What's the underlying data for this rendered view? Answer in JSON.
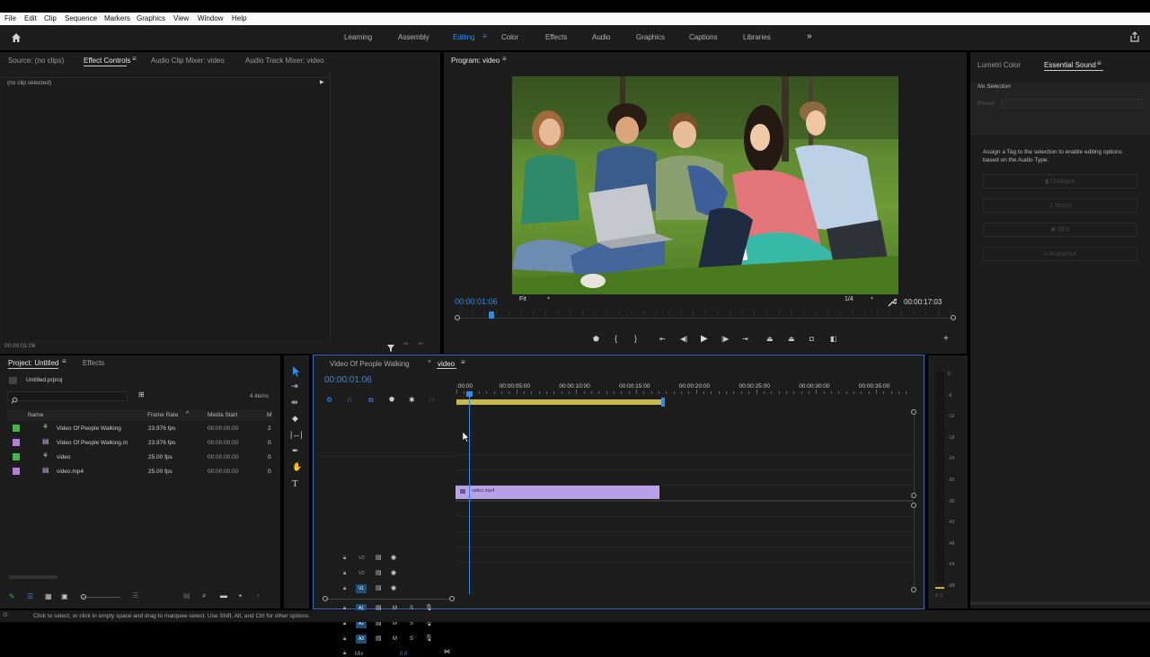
{
  "menu": [
    "File",
    "Edit",
    "Clip",
    "Sequence",
    "Markers",
    "Graphics",
    "View",
    "Window",
    "Help"
  ],
  "workspaces": {
    "items": [
      "Learning",
      "Assembly",
      "Editing",
      "Color",
      "Effects",
      "Audio",
      "Graphics",
      "Captions",
      "Libraries"
    ],
    "active": "Editing",
    "more": "»"
  },
  "source_panel": {
    "tabs": [
      "Source: (no clips)",
      "Effect Controls",
      "Audio Clip Mixer: video",
      "Audio Track Mixer: video"
    ],
    "no_clip": "(no clip selected)",
    "timecode": "00:00:01:06"
  },
  "program": {
    "title": "Program: video",
    "timecode": "00:00:01:06",
    "fit": "Fit",
    "resolution": "1/4",
    "duration": "00:00:17:03",
    "playhead_fraction": 0.065
  },
  "right_panel": {
    "tabs": [
      "Lumetri Color",
      "Essential Sound"
    ],
    "no_selection": "No Selection",
    "preset_label": "Preset",
    "description": "Assign a Tag to the selection to enable editing options based on the Audio Type.",
    "tags": [
      "Dialogue",
      "Music",
      "SFX",
      "Ambience"
    ]
  },
  "project": {
    "tabs": [
      "Project: Untitled",
      "Effects"
    ],
    "file": "Untitled.prproj",
    "item_count": "4 items",
    "columns": [
      "Name",
      "Frame Rate",
      "Media Start",
      "M"
    ],
    "items": [
      {
        "color": "#3fb54a",
        "type": "sequence",
        "name": "Video Of People Walking",
        "rate": "23.976 fps",
        "start": "00:00:00:00",
        "m": "2"
      },
      {
        "color": "#b27ee0",
        "type": "clip",
        "name": "Video Of People Walking.m",
        "rate": "23.976 fps",
        "start": "00:00:00:00",
        "m": "0"
      },
      {
        "color": "#3fb54a",
        "type": "sequence",
        "name": "video",
        "rate": "25.00 fps",
        "start": "00:00:00:00",
        "m": "0"
      },
      {
        "color": "#b27ee0",
        "type": "clip",
        "name": "video.mp4",
        "rate": "25.00 fps",
        "start": "00:00:00:00",
        "m": "0"
      }
    ]
  },
  "timeline": {
    "tabs": [
      "Video Of People Walking",
      "video"
    ],
    "active_tab": "video",
    "timecode": "00:00:01:06",
    "ruler": [
      ":00:00",
      "00:00:05:00",
      "00:00:10:00",
      "00:00:15:00",
      "00:00:20:00",
      "00:00:25:00",
      "00:00:30:00",
      "00:00:35:00"
    ],
    "video_tracks": [
      "V3",
      "V2",
      "V1"
    ],
    "audio_tracks": [
      "A1",
      "A2",
      "A3"
    ],
    "mix_label": "Mix",
    "mix_value": "0.0",
    "clip_name": "video.mp4"
  },
  "meter": {
    "ticks": [
      "0",
      "-6",
      "-12",
      "-18",
      "-24",
      "-30",
      "-36",
      "-42",
      "-48",
      "-54",
      "-dB"
    ],
    "foot": "S S"
  },
  "status": "Click to select, or click in empty space and drag to marquee select. Use Shift, Alt, and Ctrl for other options."
}
